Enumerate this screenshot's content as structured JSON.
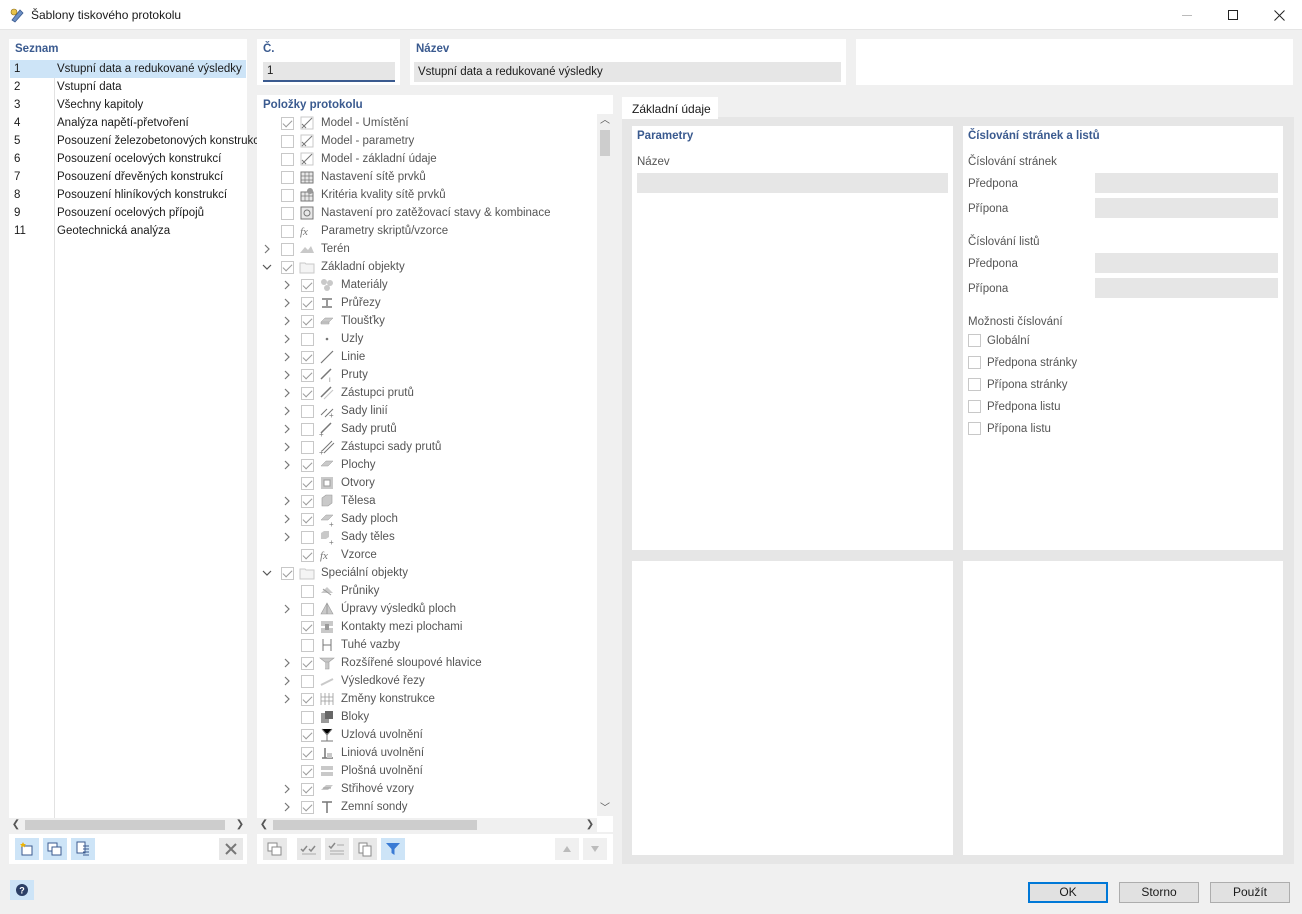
{
  "window": {
    "title": "Šablony tiskového protokolu"
  },
  "list": {
    "header": "Seznam",
    "items": [
      {
        "num": "1",
        "name": "Vstupní data a redukované výsledky",
        "selected": true
      },
      {
        "num": "2",
        "name": "Vstupní data"
      },
      {
        "num": "3",
        "name": "Všechny kapitoly"
      },
      {
        "num": "4",
        "name": "Analýza napětí-přetvoření"
      },
      {
        "num": "5",
        "name": "Posouzení železobetonových konstrukcí"
      },
      {
        "num": "6",
        "name": "Posouzení ocelových konstrukcí"
      },
      {
        "num": "7",
        "name": "Posouzení dřevěných konstrukcí"
      },
      {
        "num": "8",
        "name": "Posouzení hliníkových konstrukcí"
      },
      {
        "num": "9",
        "name": "Posouzení ocelových přípojů"
      },
      {
        "num": "11",
        "name": "Geotechnická analýza"
      }
    ]
  },
  "number": {
    "label": "Č.",
    "value": "1"
  },
  "name": {
    "label": "Název",
    "value": "Vstupní data a redukované výsledky"
  },
  "items": {
    "header": "Položky protokolu",
    "rows": [
      {
        "label": "Model - Umístění",
        "level": 0,
        "exp": "",
        "checked": true,
        "icon": "model-icon"
      },
      {
        "label": "Model - parametry",
        "level": 0,
        "exp": "",
        "checked": false,
        "icon": "model-icon"
      },
      {
        "label": "Model - základní údaje",
        "level": 0,
        "exp": "",
        "checked": false,
        "icon": "model-icon"
      },
      {
        "label": "Nastavení sítě prvků",
        "level": 0,
        "exp": "",
        "checked": false,
        "icon": "mesh-settings-icon"
      },
      {
        "label": "Kritéria kvality sítě prvků",
        "level": 0,
        "exp": "",
        "checked": false,
        "icon": "mesh-quality-icon"
      },
      {
        "label": "Nastavení pro zatěžovací stavy & kombinace",
        "level": 0,
        "exp": "",
        "checked": false,
        "icon": "load-cases-icon"
      },
      {
        "label": "Parametry skriptů/vzorce",
        "level": 0,
        "exp": "",
        "checked": false,
        "icon": "formula-icon"
      },
      {
        "label": "Terén",
        "level": 0,
        "exp": "right",
        "checked": false,
        "icon": "terrain-icon"
      },
      {
        "label": "Základní objekty",
        "level": 0,
        "exp": "down",
        "checked": true,
        "icon": "folder-icon"
      },
      {
        "label": "Materiály",
        "level": 1,
        "exp": "right",
        "checked": true,
        "icon": "materials-icon"
      },
      {
        "label": "Průřezy",
        "level": 1,
        "exp": "right",
        "checked": true,
        "icon": "sections-icon"
      },
      {
        "label": "Tloušťky",
        "level": 1,
        "exp": "right",
        "checked": true,
        "icon": "thickness-icon"
      },
      {
        "label": "Uzly",
        "level": 1,
        "exp": "right",
        "checked": false,
        "icon": "node-icon"
      },
      {
        "label": "Linie",
        "level": 1,
        "exp": "right",
        "checked": true,
        "icon": "line-icon"
      },
      {
        "label": "Pruty",
        "level": 1,
        "exp": "right",
        "checked": true,
        "icon": "member-icon"
      },
      {
        "label": "Zástupci prutů",
        "level": 1,
        "exp": "right",
        "checked": true,
        "icon": "member-rep-icon"
      },
      {
        "label": "Sady linií",
        "level": 1,
        "exp": "right",
        "checked": false,
        "icon": "line-set-icon"
      },
      {
        "label": "Sady prutů",
        "level": 1,
        "exp": "right",
        "checked": false,
        "icon": "member-set-icon"
      },
      {
        "label": "Zástupci sady prutů",
        "level": 1,
        "exp": "right",
        "checked": false,
        "icon": "member-set-rep-icon"
      },
      {
        "label": "Plochy",
        "level": 1,
        "exp": "right",
        "checked": true,
        "icon": "surface-icon"
      },
      {
        "label": "Otvory",
        "level": 1,
        "exp": "",
        "checked": true,
        "icon": "opening-icon"
      },
      {
        "label": "Tělesa",
        "level": 1,
        "exp": "right",
        "checked": true,
        "icon": "solid-icon"
      },
      {
        "label": "Sady ploch",
        "level": 1,
        "exp": "right",
        "checked": true,
        "icon": "surface-set-icon"
      },
      {
        "label": "Sady těles",
        "level": 1,
        "exp": "right",
        "checked": false,
        "icon": "solid-set-icon"
      },
      {
        "label": "Vzorce",
        "level": 1,
        "exp": "",
        "checked": true,
        "icon": "formula-icon"
      },
      {
        "label": "Speciální objekty",
        "level": 0,
        "exp": "down",
        "checked": true,
        "icon": "folder-icon"
      },
      {
        "label": "Průniky",
        "level": 1,
        "exp": "",
        "checked": false,
        "icon": "intersection-icon"
      },
      {
        "label": "Úpravy výsledků ploch",
        "level": 1,
        "exp": "right",
        "checked": false,
        "icon": "result-smoothing-icon"
      },
      {
        "label": "Kontakty mezi plochami",
        "level": 1,
        "exp": "",
        "checked": true,
        "icon": "surface-contact-icon"
      },
      {
        "label": "Tuhé vazby",
        "level": 1,
        "exp": "",
        "checked": false,
        "icon": "rigid-link-icon"
      },
      {
        "label": "Rozšířené sloupové hlavice",
        "level": 1,
        "exp": "right",
        "checked": true,
        "icon": "column-head-icon"
      },
      {
        "label": "Výsledkové řezy",
        "level": 1,
        "exp": "right",
        "checked": false,
        "icon": "result-section-icon"
      },
      {
        "label": "Změny konstrukce",
        "level": 1,
        "exp": "right",
        "checked": true,
        "icon": "structure-mod-icon"
      },
      {
        "label": "Bloky",
        "level": 1,
        "exp": "",
        "checked": false,
        "icon": "block-icon"
      },
      {
        "label": "Uzlová uvolnění",
        "level": 1,
        "exp": "",
        "checked": true,
        "icon": "nodal-release-icon"
      },
      {
        "label": "Liniová uvolnění",
        "level": 1,
        "exp": "",
        "checked": true,
        "icon": "line-release-icon"
      },
      {
        "label": "Plošná uvolnění",
        "level": 1,
        "exp": "",
        "checked": true,
        "icon": "surface-release-icon"
      },
      {
        "label": "Střihové vzory",
        "level": 1,
        "exp": "right",
        "checked": true,
        "icon": "cutting-pattern-icon"
      },
      {
        "label": "Zemní sondy",
        "level": 1,
        "exp": "right",
        "checked": true,
        "icon": "borehole-icon"
      }
    ]
  },
  "tab": {
    "label": "Základní údaje"
  },
  "params": {
    "title": "Parametry",
    "name_label": "Název"
  },
  "numbering": {
    "title": "Číslování stránek a listů",
    "pages_label": "Číslování stránek",
    "prefix_label": "Předpona",
    "suffix_label": "Přípona",
    "sheets_label": "Číslování listů",
    "sheet_prefix_label": "Předpona",
    "sheet_suffix_label": "Přípona",
    "options_label": "Možnosti číslování",
    "options": [
      "Globální",
      "Předpona stránky",
      "Přípona stránky",
      "Předpona listu",
      "Přípona listu"
    ]
  },
  "buttons": {
    "ok": "OK",
    "cancel": "Storno",
    "apply": "Použít"
  }
}
